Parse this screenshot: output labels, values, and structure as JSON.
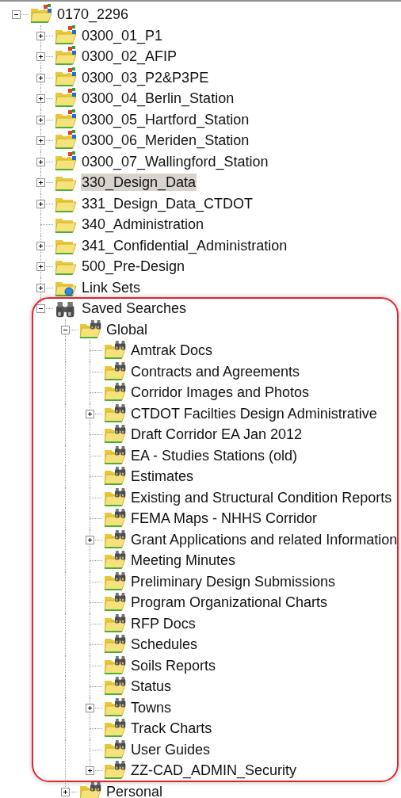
{
  "tree": [
    {
      "label": "0170_2296",
      "kind": "project",
      "expanded": true,
      "selected": false,
      "children": [
        {
          "label": "0300_01_P1",
          "kind": "project",
          "expanded": false,
          "selected": false
        },
        {
          "label": "0300_02_AFIP",
          "kind": "project",
          "expanded": false,
          "selected": false
        },
        {
          "label": "0300_03_P2&P3PE",
          "kind": "project",
          "expanded": false,
          "selected": false
        },
        {
          "label": "0300_04_Berlin_Station",
          "kind": "project",
          "expanded": false,
          "selected": false
        },
        {
          "label": "0300_05_Hartford_Station",
          "kind": "project",
          "expanded": false,
          "selected": false
        },
        {
          "label": "0300_06_Meriden_Station",
          "kind": "project",
          "expanded": false,
          "selected": false
        },
        {
          "label": "0300_07_Wallingford_Station",
          "kind": "project",
          "expanded": false,
          "selected": false
        },
        {
          "label": "330_Design_Data",
          "kind": "folder",
          "expanded": false,
          "selected": true
        },
        {
          "label": "331_Design_Data_CTDOT",
          "kind": "folder",
          "expanded": false,
          "selected": false
        },
        {
          "label": "340_Administration",
          "kind": "folder",
          "selected": false
        },
        {
          "label": "341_Confidential_Administration",
          "kind": "folder",
          "expanded": false,
          "selected": false
        },
        {
          "label": "500_Pre-Design",
          "kind": "folder",
          "expanded": false,
          "selected": false
        },
        {
          "label": "Link Sets",
          "kind": "link-set",
          "expanded": false,
          "selected": false
        },
        {
          "label": "Saved Searches",
          "kind": "searches",
          "expanded": true,
          "selected": false,
          "children": [
            {
              "label": "Global",
              "kind": "search-folder",
              "expanded": true,
              "selected": false,
              "children": [
                {
                  "label": "Amtrak Docs",
                  "kind": "search-folder",
                  "selected": false
                },
                {
                  "label": "Contracts and Agreements",
                  "kind": "search-folder",
                  "selected": false
                },
                {
                  "label": "Corridor Images and Photos",
                  "kind": "search-folder",
                  "selected": false
                },
                {
                  "label": "CTDOT Facilties Design Administrative",
                  "kind": "search-folder",
                  "expanded": false,
                  "selected": false
                },
                {
                  "label": "Draft Corridor EA Jan 2012",
                  "kind": "search-folder",
                  "selected": false
                },
                {
                  "label": "EA - Studies Stations (old)",
                  "kind": "search-folder",
                  "selected": false
                },
                {
                  "label": "Estimates",
                  "kind": "search-folder",
                  "selected": false
                },
                {
                  "label": "Existing and Structural Condition Reports",
                  "kind": "search-folder",
                  "selected": false
                },
                {
                  "label": "FEMA Maps - NHHS Corridor",
                  "kind": "search-folder",
                  "selected": false
                },
                {
                  "label": "Grant Applications and related Information",
                  "kind": "search-folder",
                  "expanded": false,
                  "selected": false
                },
                {
                  "label": "Meeting Minutes",
                  "kind": "search-folder",
                  "selected": false
                },
                {
                  "label": "Preliminary Design Submissions",
                  "kind": "search-folder",
                  "selected": false
                },
                {
                  "label": "Program Organizational Charts",
                  "kind": "search-folder",
                  "selected": false
                },
                {
                  "label": "RFP Docs",
                  "kind": "search-folder",
                  "selected": false
                },
                {
                  "label": "Schedules",
                  "kind": "search-folder",
                  "selected": false
                },
                {
                  "label": "Soils Reports",
                  "kind": "search-folder",
                  "selected": false
                },
                {
                  "label": "Status",
                  "kind": "search-folder",
                  "selected": false
                },
                {
                  "label": "Towns",
                  "kind": "search-folder",
                  "expanded": false,
                  "selected": false
                },
                {
                  "label": "Track Charts",
                  "kind": "search-folder",
                  "selected": false
                },
                {
                  "label": "User Guides",
                  "kind": "search-folder",
                  "selected": false
                },
                {
                  "label": "ZZ-CAD_ADMIN_Security",
                  "kind": "search-folder",
                  "expanded": false,
                  "selected": false
                }
              ]
            },
            {
              "label": "Personal",
              "kind": "search-folder",
              "expanded": false,
              "selected": false
            }
          ]
        }
      ]
    }
  ]
}
